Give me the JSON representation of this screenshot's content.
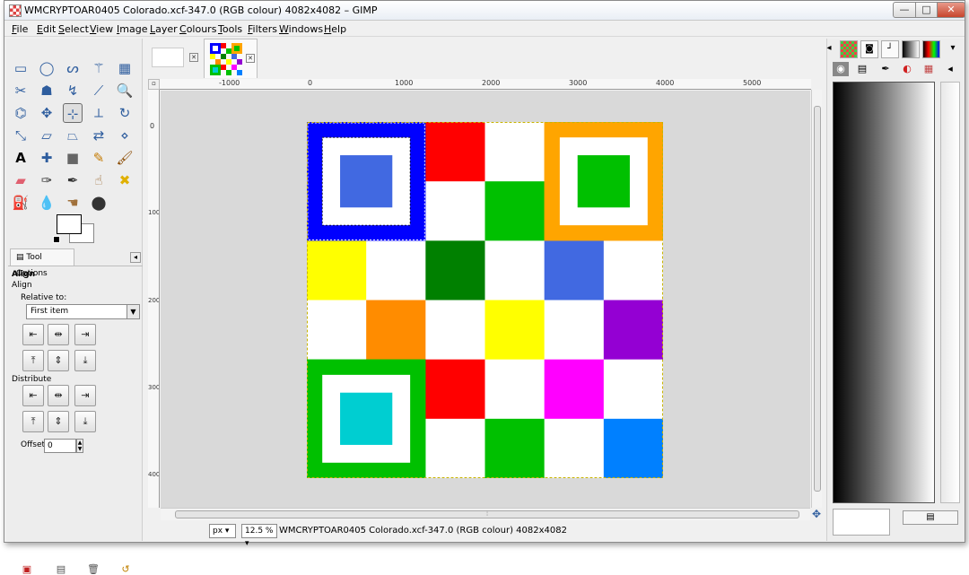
{
  "window": {
    "title": "WMCRYPTOAR0405 Colorado.xcf-347.0 (RGB colour) 4082x4082 – GIMP",
    "controls": {
      "minimize": "—",
      "maximize": "□",
      "close": "✕"
    }
  },
  "menu": [
    "File",
    "Edit",
    "Select",
    "View",
    "Image",
    "Layer",
    "Colours",
    "Tools",
    "Filters",
    "Windows",
    "Help"
  ],
  "toolbox": {
    "tools": [
      "rect-select",
      "ellipse-select",
      "free-select",
      "fuzzy-select",
      "by-color-select",
      "scissors",
      "foreground-select",
      "paths",
      "color-picker",
      "zoom",
      "measure",
      "move",
      "align",
      "crop",
      "rotate",
      "scale",
      "shear",
      "perspective",
      "flip",
      "cage",
      "text",
      "heal",
      "clone",
      "pencil",
      "paintbrush",
      "eraser",
      "airbrush",
      "ink",
      "smudge",
      "dodge-burn",
      "bucket-fill",
      "blend",
      "convolve",
      "smudge2"
    ],
    "tool_options_tab": "Tool Options",
    "align_heading": "Align",
    "align_sub": "Align",
    "relative_to_label": "Relative to:",
    "relative_to_value": "First item",
    "distribute_label": "Distribute",
    "offset_label": "Offset:",
    "offset_value": "0"
  },
  "ruler": {
    "h_ticks": [
      "-1000",
      "0",
      "1000",
      "2000",
      "3000",
      "4000",
      "5000"
    ],
    "v_ticks": [
      "0",
      "1000",
      "2000",
      "3000",
      "4000"
    ]
  },
  "image": {
    "grid": [
      [
        "#0000ff",
        "#0000ff",
        "#ff0000",
        "#ffffff",
        "#ffa500",
        "#ffa500"
      ],
      [
        "#0000ff",
        "#0000ff",
        "#ffffff",
        "#00c000",
        "#ffa500",
        "#ffa500"
      ],
      [
        "#ffff00",
        "#ffffff",
        "#008000",
        "#ffffff",
        "#4169e1",
        "#ffffff"
      ],
      [
        "#ffffff",
        "#ff8c00",
        "#ffffff",
        "#ffff00",
        "#ffffff",
        "#9400d3"
      ],
      [
        "#00c000",
        "#00c000",
        "#ff0000",
        "#ffffff",
        "#ff00ff",
        "#ffffff"
      ],
      [
        "#00c000",
        "#00c000",
        "#ffffff",
        "#00c000",
        "#ffffff",
        "#0080ff"
      ]
    ],
    "blocks": [
      {
        "frame": "#0000ff",
        "inner": "#4169e1",
        "dashed": true
      },
      {
        "frame": "#ffa500",
        "inner": "#00c000",
        "dashed": false
      },
      {
        "frame": "#00c000",
        "inner": "#00ced1",
        "dashed": false
      }
    ]
  },
  "status": {
    "unit": "px",
    "zoom": "12.5 %",
    "text": "WMCRYPTOAR0405 Colorado.xcf-347.0 (RGB colour) 4082x4082"
  }
}
